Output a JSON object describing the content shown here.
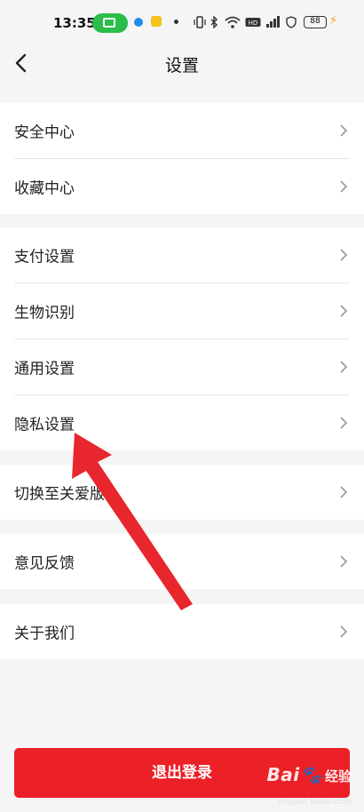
{
  "status_bar": {
    "time": "13:35",
    "battery": "88"
  },
  "header": {
    "title": "设置"
  },
  "groups": [
    {
      "items": [
        {
          "label": "安全中心"
        },
        {
          "label": "收藏中心"
        }
      ]
    },
    {
      "items": [
        {
          "label": "支付设置"
        },
        {
          "label": "生物识别"
        },
        {
          "label": "通用设置"
        },
        {
          "label": "隐私设置"
        }
      ]
    },
    {
      "items": [
        {
          "label": "切换至关爱版"
        }
      ]
    },
    {
      "items": [
        {
          "label": "意见反馈"
        }
      ]
    },
    {
      "items": [
        {
          "label": "关于我们"
        }
      ]
    }
  ],
  "logout_label": "退出登录",
  "watermark": {
    "brand": "Bai",
    "brand_suffix": "经验",
    "url": "jingyan.baidu.com"
  },
  "colors": {
    "logout": "#ec2027",
    "arrow": "#e8262d",
    "background": "#f5f5f5",
    "status_pill": "#2bbd4a"
  }
}
